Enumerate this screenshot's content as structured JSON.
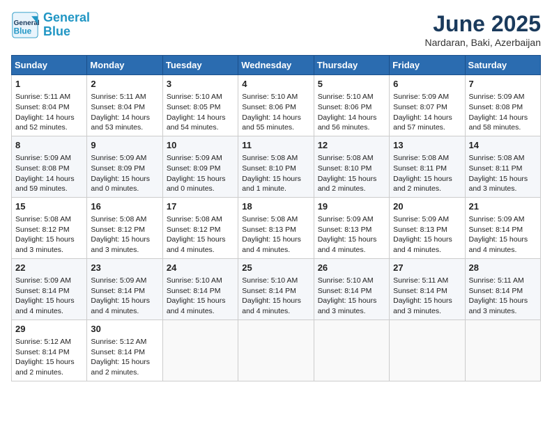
{
  "header": {
    "logo_line1": "General",
    "logo_line2": "Blue",
    "month": "June 2025",
    "location": "Nardaran, Baki, Azerbaijan"
  },
  "weekdays": [
    "Sunday",
    "Monday",
    "Tuesday",
    "Wednesday",
    "Thursday",
    "Friday",
    "Saturday"
  ],
  "weeks": [
    [
      {
        "day": "1",
        "info": "Sunrise: 5:11 AM\nSunset: 8:04 PM\nDaylight: 14 hours\nand 52 minutes."
      },
      {
        "day": "2",
        "info": "Sunrise: 5:11 AM\nSunset: 8:04 PM\nDaylight: 14 hours\nand 53 minutes."
      },
      {
        "day": "3",
        "info": "Sunrise: 5:10 AM\nSunset: 8:05 PM\nDaylight: 14 hours\nand 54 minutes."
      },
      {
        "day": "4",
        "info": "Sunrise: 5:10 AM\nSunset: 8:06 PM\nDaylight: 14 hours\nand 55 minutes."
      },
      {
        "day": "5",
        "info": "Sunrise: 5:10 AM\nSunset: 8:06 PM\nDaylight: 14 hours\nand 56 minutes."
      },
      {
        "day": "6",
        "info": "Sunrise: 5:09 AM\nSunset: 8:07 PM\nDaylight: 14 hours\nand 57 minutes."
      },
      {
        "day": "7",
        "info": "Sunrise: 5:09 AM\nSunset: 8:08 PM\nDaylight: 14 hours\nand 58 minutes."
      }
    ],
    [
      {
        "day": "8",
        "info": "Sunrise: 5:09 AM\nSunset: 8:08 PM\nDaylight: 14 hours\nand 59 minutes."
      },
      {
        "day": "9",
        "info": "Sunrise: 5:09 AM\nSunset: 8:09 PM\nDaylight: 15 hours\nand 0 minutes."
      },
      {
        "day": "10",
        "info": "Sunrise: 5:09 AM\nSunset: 8:09 PM\nDaylight: 15 hours\nand 0 minutes."
      },
      {
        "day": "11",
        "info": "Sunrise: 5:08 AM\nSunset: 8:10 PM\nDaylight: 15 hours\nand 1 minute."
      },
      {
        "day": "12",
        "info": "Sunrise: 5:08 AM\nSunset: 8:10 PM\nDaylight: 15 hours\nand 2 minutes."
      },
      {
        "day": "13",
        "info": "Sunrise: 5:08 AM\nSunset: 8:11 PM\nDaylight: 15 hours\nand 2 minutes."
      },
      {
        "day": "14",
        "info": "Sunrise: 5:08 AM\nSunset: 8:11 PM\nDaylight: 15 hours\nand 3 minutes."
      }
    ],
    [
      {
        "day": "15",
        "info": "Sunrise: 5:08 AM\nSunset: 8:12 PM\nDaylight: 15 hours\nand 3 minutes."
      },
      {
        "day": "16",
        "info": "Sunrise: 5:08 AM\nSunset: 8:12 PM\nDaylight: 15 hours\nand 3 minutes."
      },
      {
        "day": "17",
        "info": "Sunrise: 5:08 AM\nSunset: 8:12 PM\nDaylight: 15 hours\nand 4 minutes."
      },
      {
        "day": "18",
        "info": "Sunrise: 5:08 AM\nSunset: 8:13 PM\nDaylight: 15 hours\nand 4 minutes."
      },
      {
        "day": "19",
        "info": "Sunrise: 5:09 AM\nSunset: 8:13 PM\nDaylight: 15 hours\nand 4 minutes."
      },
      {
        "day": "20",
        "info": "Sunrise: 5:09 AM\nSunset: 8:13 PM\nDaylight: 15 hours\nand 4 minutes."
      },
      {
        "day": "21",
        "info": "Sunrise: 5:09 AM\nSunset: 8:14 PM\nDaylight: 15 hours\nand 4 minutes."
      }
    ],
    [
      {
        "day": "22",
        "info": "Sunrise: 5:09 AM\nSunset: 8:14 PM\nDaylight: 15 hours\nand 4 minutes."
      },
      {
        "day": "23",
        "info": "Sunrise: 5:09 AM\nSunset: 8:14 PM\nDaylight: 15 hours\nand 4 minutes."
      },
      {
        "day": "24",
        "info": "Sunrise: 5:10 AM\nSunset: 8:14 PM\nDaylight: 15 hours\nand 4 minutes."
      },
      {
        "day": "25",
        "info": "Sunrise: 5:10 AM\nSunset: 8:14 PM\nDaylight: 15 hours\nand 4 minutes."
      },
      {
        "day": "26",
        "info": "Sunrise: 5:10 AM\nSunset: 8:14 PM\nDaylight: 15 hours\nand 3 minutes."
      },
      {
        "day": "27",
        "info": "Sunrise: 5:11 AM\nSunset: 8:14 PM\nDaylight: 15 hours\nand 3 minutes."
      },
      {
        "day": "28",
        "info": "Sunrise: 5:11 AM\nSunset: 8:14 PM\nDaylight: 15 hours\nand 3 minutes."
      }
    ],
    [
      {
        "day": "29",
        "info": "Sunrise: 5:12 AM\nSunset: 8:14 PM\nDaylight: 15 hours\nand 2 minutes."
      },
      {
        "day": "30",
        "info": "Sunrise: 5:12 AM\nSunset: 8:14 PM\nDaylight: 15 hours\nand 2 minutes."
      },
      {
        "day": "",
        "info": ""
      },
      {
        "day": "",
        "info": ""
      },
      {
        "day": "",
        "info": ""
      },
      {
        "day": "",
        "info": ""
      },
      {
        "day": "",
        "info": ""
      }
    ]
  ]
}
